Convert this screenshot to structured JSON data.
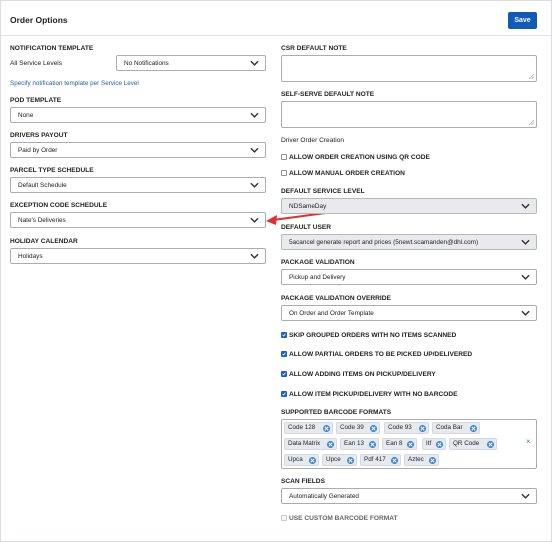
{
  "header": {
    "title": "Order Options",
    "save_label": "Save"
  },
  "left": {
    "notification_template": {
      "label": "NOTIFICATION TEMPLATE",
      "scope": "All Service Levels",
      "value": "No Notifications",
      "link": "Specify notification template per Service Level"
    },
    "pod_template": {
      "label": "POD TEMPLATE",
      "value": "None"
    },
    "drivers_payout": {
      "label": "DRIVERS PAYOUT",
      "value": "Paid by Order"
    },
    "parcel_type_schedule": {
      "label": "PARCEL TYPE SCHEDULE",
      "value": "Default Schedule"
    },
    "exception_code_schedule": {
      "label": "EXCEPTION CODE SCHEDULE",
      "value": "Nate's Deliveries"
    },
    "holiday_calendar": {
      "label": "HOLIDAY CALENDAR",
      "value": "Holidays"
    }
  },
  "right": {
    "csr_default_note": {
      "label": "CSR DEFAULT NOTE",
      "value": ""
    },
    "self_serve_default_note": {
      "label": "SELF-SERVE DEFAULT NOTE",
      "value": ""
    },
    "driver_order_creation": {
      "label": "Driver Order Creation",
      "qr": {
        "label": "ALLOW ORDER CREATION USING QR CODE",
        "checked": false
      },
      "manual": {
        "label": "ALLOW MANUAL ORDER CREATION",
        "checked": false
      }
    },
    "default_service_level": {
      "label": "DEFAULT SERVICE LEVEL",
      "value": "NDSameDay"
    },
    "default_user": {
      "label": "DEFAULT USER",
      "value": "5acancel generate report and prices (5newt.scamanden@dhl.com)"
    },
    "package_validation": {
      "label": "PACKAGE VALIDATION",
      "value": "Pickup and Delivery"
    },
    "package_validation_override": {
      "label": "PACKAGE VALIDATION OVERRIDE",
      "value": "On Order and Order Template"
    },
    "checks": [
      {
        "label": "SKIP GROUPED ORDERS WITH NO ITEMS SCANNED",
        "checked": true
      },
      {
        "label": "ALLOW PARTIAL ORDERS TO BE PICKED UP/DELIVERED",
        "checked": true
      },
      {
        "label": "ALLOW ADDING ITEMS ON PICKUP/DELIVERY",
        "checked": true
      },
      {
        "label": "ALLOW ITEM PICKUP/DELIVERY WITH NO BARCODE",
        "checked": true
      }
    ],
    "supported_barcode_formats": {
      "label": "SUPPORTED BARCODE FORMATS",
      "tags": [
        "Code 128",
        "Code 39",
        "Code 93",
        "Coda Bar",
        "Data Matrix",
        "Ean 13",
        "Ean 8",
        "Itf",
        "QR Code",
        "Upca",
        "Upce",
        "Pdf 417",
        "Aztec"
      ],
      "clear_icon": "close-icon"
    },
    "scan_fields": {
      "label": "SCAN FIELDS",
      "value": "Automatically Generated"
    },
    "use_custom_barcode_format": {
      "label": "USE CUSTOM BARCODE FORMAT",
      "checked": false
    }
  },
  "colors": {
    "accent": "#0f5bb5",
    "checkbox": "#1d63c4",
    "link": "#1f5fae",
    "annotation_arrow": "#e0302a"
  }
}
